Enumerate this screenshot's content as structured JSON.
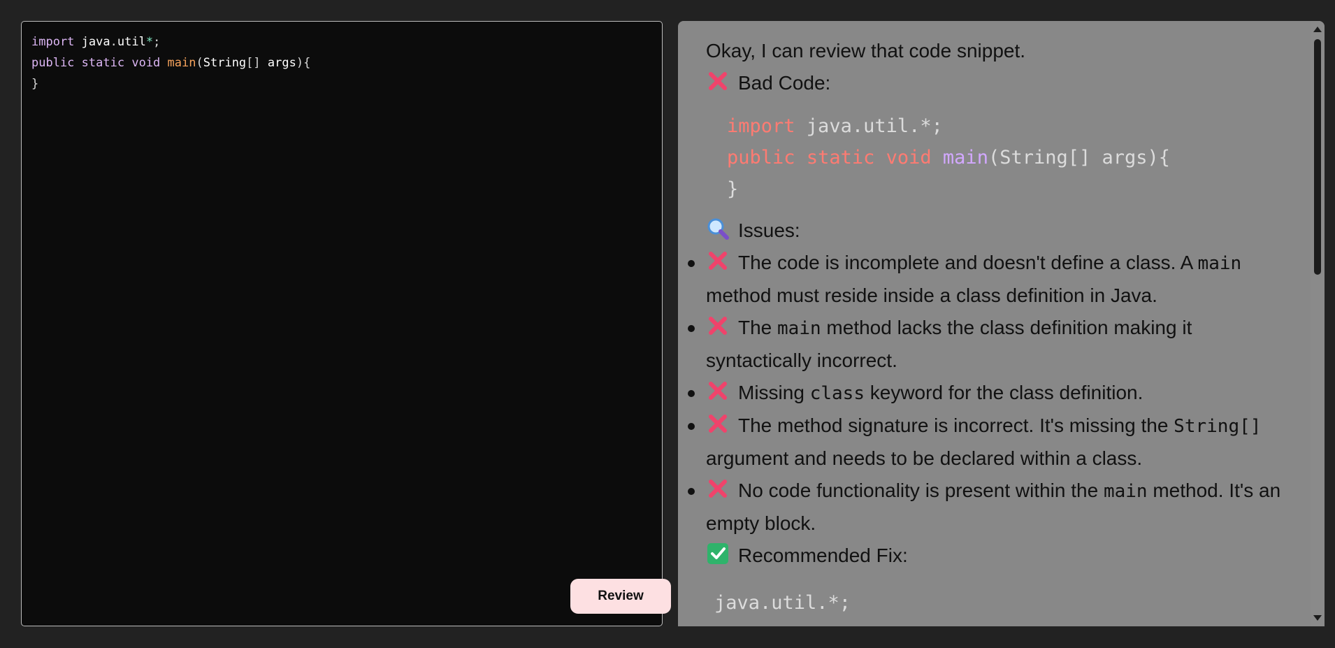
{
  "editor": {
    "lines": [
      [
        {
          "t": "import",
          "c": "kw"
        },
        {
          "t": " ",
          "c": "punc"
        },
        {
          "t": "java",
          "c": "id"
        },
        {
          "t": ".",
          "c": "punc"
        },
        {
          "t": "util",
          "c": "id"
        },
        {
          "t": "*",
          "c": "star"
        },
        {
          "t": ";",
          "c": "punc"
        }
      ],
      [
        {
          "t": "public",
          "c": "kw"
        },
        {
          "t": " ",
          "c": "punc"
        },
        {
          "t": "static",
          "c": "kw"
        },
        {
          "t": " ",
          "c": "punc"
        },
        {
          "t": "void",
          "c": "kw"
        },
        {
          "t": " ",
          "c": "punc"
        },
        {
          "t": "main",
          "c": "fn"
        },
        {
          "t": "(",
          "c": "punc"
        },
        {
          "t": "String",
          "c": "id"
        },
        {
          "t": "[] ",
          "c": "punc"
        },
        {
          "t": "args",
          "c": "id"
        },
        {
          "t": "){",
          "c": "punc"
        }
      ],
      [
        {
          "t": "}",
          "c": "punc"
        }
      ]
    ],
    "review_button_label": "Review"
  },
  "review": {
    "intro": "Okay, I can review that code snippet.",
    "bad_code_heading": "Bad Code:",
    "bad_code_lines": [
      [
        {
          "t": "import",
          "c": "cb-kw"
        },
        {
          "t": " java.util.*;",
          "c": ""
        }
      ],
      [
        {
          "t": "public",
          "c": "cb-kw"
        },
        {
          "t": " ",
          "c": ""
        },
        {
          "t": "static",
          "c": "cb-kw"
        },
        {
          "t": " ",
          "c": ""
        },
        {
          "t": "void",
          "c": "cb-kw"
        },
        {
          "t": " ",
          "c": ""
        },
        {
          "t": "main",
          "c": "cb-fn"
        },
        {
          "t": "(String[] args){",
          "c": ""
        }
      ],
      [
        {
          "t": "}",
          "c": ""
        }
      ]
    ],
    "issues_heading": "Issues:",
    "issues": [
      {
        "before": "The code is incomplete and doesn't define a class. A ",
        "code": "main",
        "after": " method must reside inside a class definition in Java."
      },
      {
        "before": "The ",
        "code": "main",
        "after": " method lacks the class definition making it syntactically incorrect."
      },
      {
        "before": "Missing ",
        "code": "class",
        "after": " keyword for the class definition."
      },
      {
        "before": "The method signature is incorrect. It's missing the ",
        "code": "String[]",
        "after": " argument and needs to be declared within a class."
      },
      {
        "before": "No code functionality is present within the ",
        "code": "main",
        "after": " method. It's an empty block."
      }
    ],
    "fix_heading": "Recommended Fix:",
    "fix_code_partial": "java.util.*;"
  },
  "icons": {
    "bad": "cross-mark-icon",
    "issues": "magnifier-icon",
    "fix": "check-mark-icon"
  },
  "colors": {
    "editor_bg": "#0c0c0c",
    "review_bg": "#888888",
    "button_bg": "#fde0e2",
    "cross": "#f0436b",
    "check": "#2fb36b"
  }
}
